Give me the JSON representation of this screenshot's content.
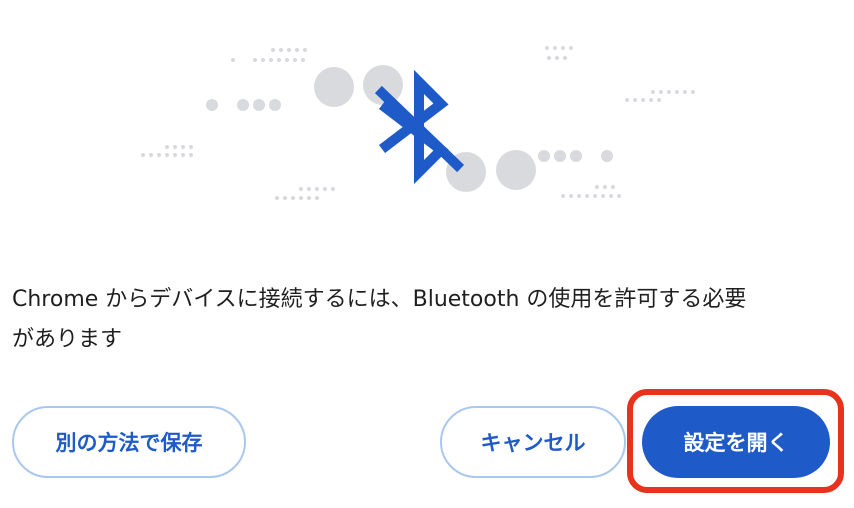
{
  "dialog": {
    "message_line1": "Chrome からデバイスに接続するには、Bluetooth の使用を許可する必要",
    "message_line2": "があります"
  },
  "buttons": {
    "save_other": "別の方法で保存",
    "cancel": "キャンセル",
    "open_settings": "設定を開く"
  },
  "colors": {
    "accent": "#1f5bc8",
    "outline": "#aac7ee",
    "highlight": "#e8321e",
    "dots": "#d9dade"
  },
  "icons": {
    "illustration": "bluetooth-disabled-icon"
  }
}
